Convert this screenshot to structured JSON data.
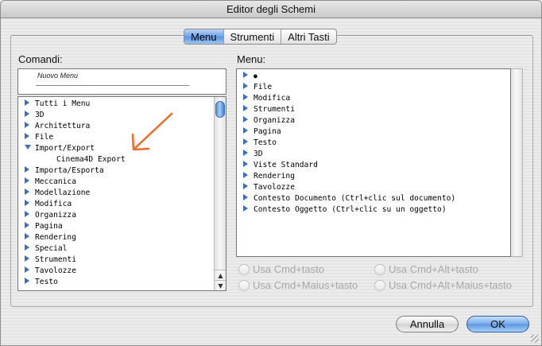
{
  "window": {
    "title": "Editor degli Schemi"
  },
  "tabs": [
    {
      "label": "Menu",
      "active": true
    },
    {
      "label": "Strumenti",
      "active": false
    },
    {
      "label": "Altri Tasti",
      "active": false
    }
  ],
  "commands": {
    "label": "Comandi:",
    "new_menu_name": "Nuovo Menu",
    "items": [
      {
        "label": "Tutti i Menu",
        "type": "collapsed",
        "indent": 0
      },
      {
        "label": "3D",
        "type": "collapsed",
        "indent": 0
      },
      {
        "label": "Architettura",
        "type": "collapsed",
        "indent": 0
      },
      {
        "label": "File",
        "type": "collapsed",
        "indent": 0
      },
      {
        "label": "Import/Export",
        "type": "expanded",
        "indent": 0
      },
      {
        "label": "Cinema4D Export",
        "type": "leaf",
        "indent": 1
      },
      {
        "label": "Importa/Esporta",
        "type": "collapsed",
        "indent": 0
      },
      {
        "label": "Meccanica",
        "type": "collapsed",
        "indent": 0
      },
      {
        "label": "Modellazione",
        "type": "collapsed",
        "indent": 0
      },
      {
        "label": "Modifica",
        "type": "collapsed",
        "indent": 0
      },
      {
        "label": "Organizza",
        "type": "collapsed",
        "indent": 0
      },
      {
        "label": "Pagina",
        "type": "collapsed",
        "indent": 0
      },
      {
        "label": "Rendering",
        "type": "collapsed",
        "indent": 0
      },
      {
        "label": "Special",
        "type": "collapsed",
        "indent": 0
      },
      {
        "label": "Strumenti",
        "type": "collapsed",
        "indent": 0
      },
      {
        "label": "Tavolozze",
        "type": "collapsed",
        "indent": 0
      },
      {
        "label": "Testo",
        "type": "collapsed",
        "indent": 0
      }
    ]
  },
  "menu": {
    "label": "Menu:",
    "items": [
      {
        "label": "",
        "type": "collapsed",
        "icon": "apple-icon"
      },
      {
        "label": "File",
        "type": "collapsed"
      },
      {
        "label": "Modifica",
        "type": "collapsed"
      },
      {
        "label": "Strumenti",
        "type": "collapsed"
      },
      {
        "label": "Organizza",
        "type": "collapsed"
      },
      {
        "label": "Pagina",
        "type": "collapsed"
      },
      {
        "label": "Testo",
        "type": "collapsed"
      },
      {
        "label": "3D",
        "type": "collapsed"
      },
      {
        "label": "Viste Standard",
        "type": "collapsed"
      },
      {
        "label": "Rendering",
        "type": "collapsed"
      },
      {
        "label": "Tavolozze",
        "type": "collapsed"
      },
      {
        "label": "Contesto Documento (Ctrl+clic sul documento)",
        "type": "collapsed"
      },
      {
        "label": "Contesto Oggetto (Ctrl+clic su un oggetto)",
        "type": "collapsed"
      }
    ]
  },
  "shortcuts": {
    "cmd": "Usa Cmd+tasto",
    "cmd_alt": "Usa Cmd+Alt+tasto",
    "cmd_shift": "Usa Cmd+Maius+tasto",
    "cmd_alt_shift": "Usa Cmd+Alt+Maius+tasto"
  },
  "buttons": {
    "cancel": "Annulla",
    "ok": "OK"
  },
  "colors": {
    "accent": "#5894de",
    "annotation": "#f06a28",
    "disclosure": "#3c6fbf"
  }
}
